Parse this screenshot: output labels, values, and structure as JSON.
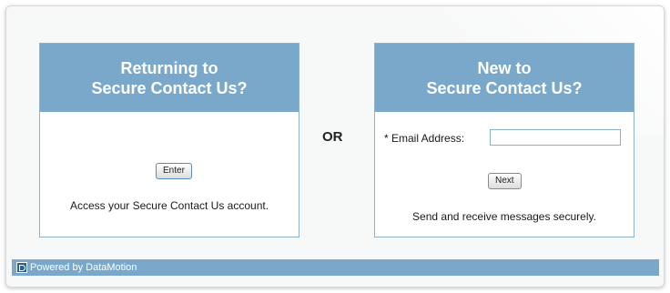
{
  "returning": {
    "title_line1": "Returning to",
    "title_line2": "Secure Contact Us?",
    "enter_label": "Enter",
    "caption": "Access your Secure Contact Us account."
  },
  "divider": "OR",
  "new_user": {
    "title_line1": "New to",
    "title_line2": "Secure Contact Us?",
    "email_label": "* Email Address:",
    "email_value": "",
    "next_label": "Next",
    "caption": "Send and receive messages securely."
  },
  "footer": {
    "logo_icon": "datamotion-logo-icon",
    "text": "Powered by DataMotion"
  }
}
